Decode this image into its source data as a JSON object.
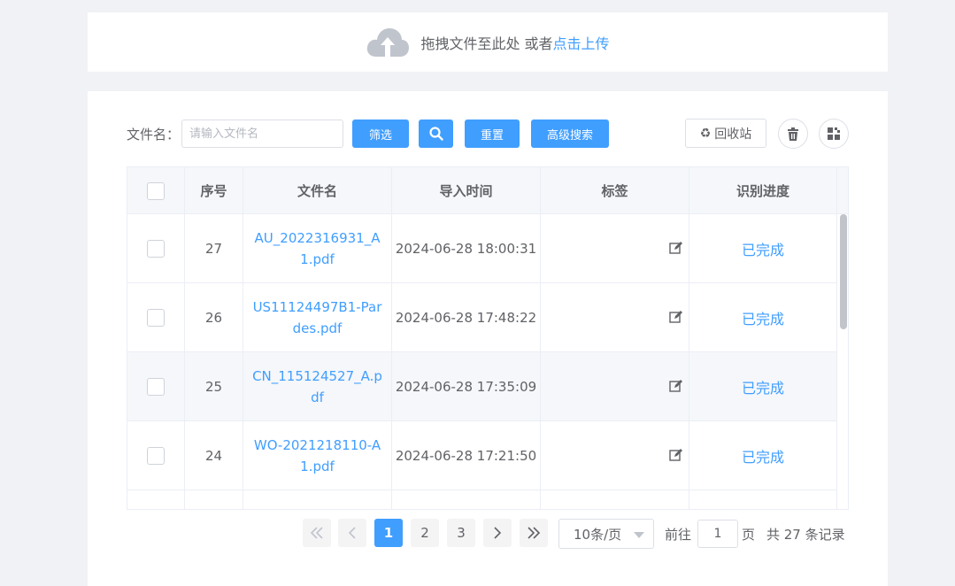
{
  "upload": {
    "hint": "拖拽文件至此处 或者",
    "link": "点击上传"
  },
  "filter": {
    "label": "文件名：",
    "placeholder": "请输入文件名",
    "filter_label": "筛选",
    "reset_label": "重置",
    "advanced_label": "高级搜索",
    "recycle_label": "回收站"
  },
  "table": {
    "headers": [
      "序号",
      "文件名",
      "导入时间",
      "标签",
      "识别进度"
    ],
    "rows": [
      {
        "no": "27",
        "name": "AU_2022316931_A1.pdf",
        "time": "2024-06-28 18:00:31",
        "status": "已完成"
      },
      {
        "no": "26",
        "name": "US11124497B1-Pardes.pdf",
        "time": "2024-06-28 17:48:22",
        "status": "已完成"
      },
      {
        "no": "25",
        "name": "CN_115124527_A.pdf",
        "time": "2024-06-28 17:35:09",
        "status": "已完成"
      },
      {
        "no": "24",
        "name": "WO-2021218110-A1.pdf",
        "time": "2024-06-28 17:21:50",
        "status": "已完成"
      }
    ]
  },
  "pager": {
    "pages": [
      "1",
      "2",
      "3"
    ],
    "page_size": "10条/页",
    "goto_prefix": "前往",
    "goto_value": "1",
    "goto_suffix": "页",
    "total": "共 27 条记录"
  },
  "colors": {
    "accent": "#409eff",
    "border": "#dcdfe6",
    "header_bg": "#f5f7fa"
  }
}
